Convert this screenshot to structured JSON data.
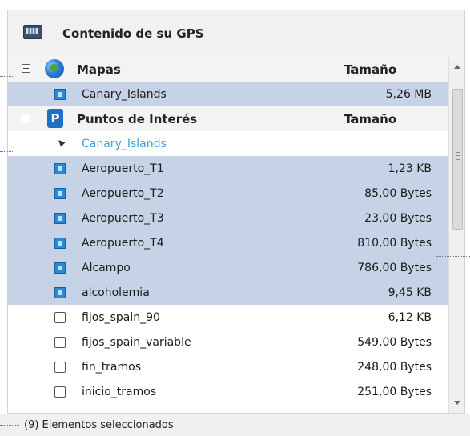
{
  "header": {
    "title": "Contenido de su GPS"
  },
  "groups": {
    "maps": {
      "label": "Mapas",
      "size_header": "Tamaño",
      "items": [
        {
          "name": "Canary_Islands",
          "size": "5,26 MB"
        }
      ]
    },
    "poi": {
      "label": "Puntos de Interés",
      "size_header": "Tamaño",
      "subgroup": "Canary_Islands",
      "items": [
        {
          "name": "Aeropuerto_T1",
          "size": "1,23 KB"
        },
        {
          "name": "Aeropuerto_T2",
          "size": "85,00 Bytes"
        },
        {
          "name": "Aeropuerto_T3",
          "size": "23,00 Bytes"
        },
        {
          "name": "Aeropuerto_T4",
          "size": "810,00 Bytes"
        },
        {
          "name": "Alcampo",
          "size": "786,00 Bytes"
        },
        {
          "name": "alcoholemia",
          "size": "9,45 KB"
        },
        {
          "name": "fijos_spain_90",
          "size": "6,12 KB"
        },
        {
          "name": "fijos_spain_variable",
          "size": "549,00 Bytes"
        },
        {
          "name": "fin_tramos",
          "size": "248,00 Bytes"
        },
        {
          "name": "inicio_tramos",
          "size": "251,00 Bytes"
        }
      ]
    }
  },
  "status": {
    "text": "(9) Elementos seleccionados"
  },
  "colors": {
    "selected_row": "#c6d3e6",
    "link": "#3aa0d8",
    "accent_icon": "#2a8ad8"
  },
  "icons": [
    "gps-device-icon",
    "globe-icon",
    "poi-icon",
    "collapse-icon",
    "checkbox-icon",
    "tree-expanded-icon",
    "scroll-up-icon",
    "scroll-down-icon"
  ]
}
